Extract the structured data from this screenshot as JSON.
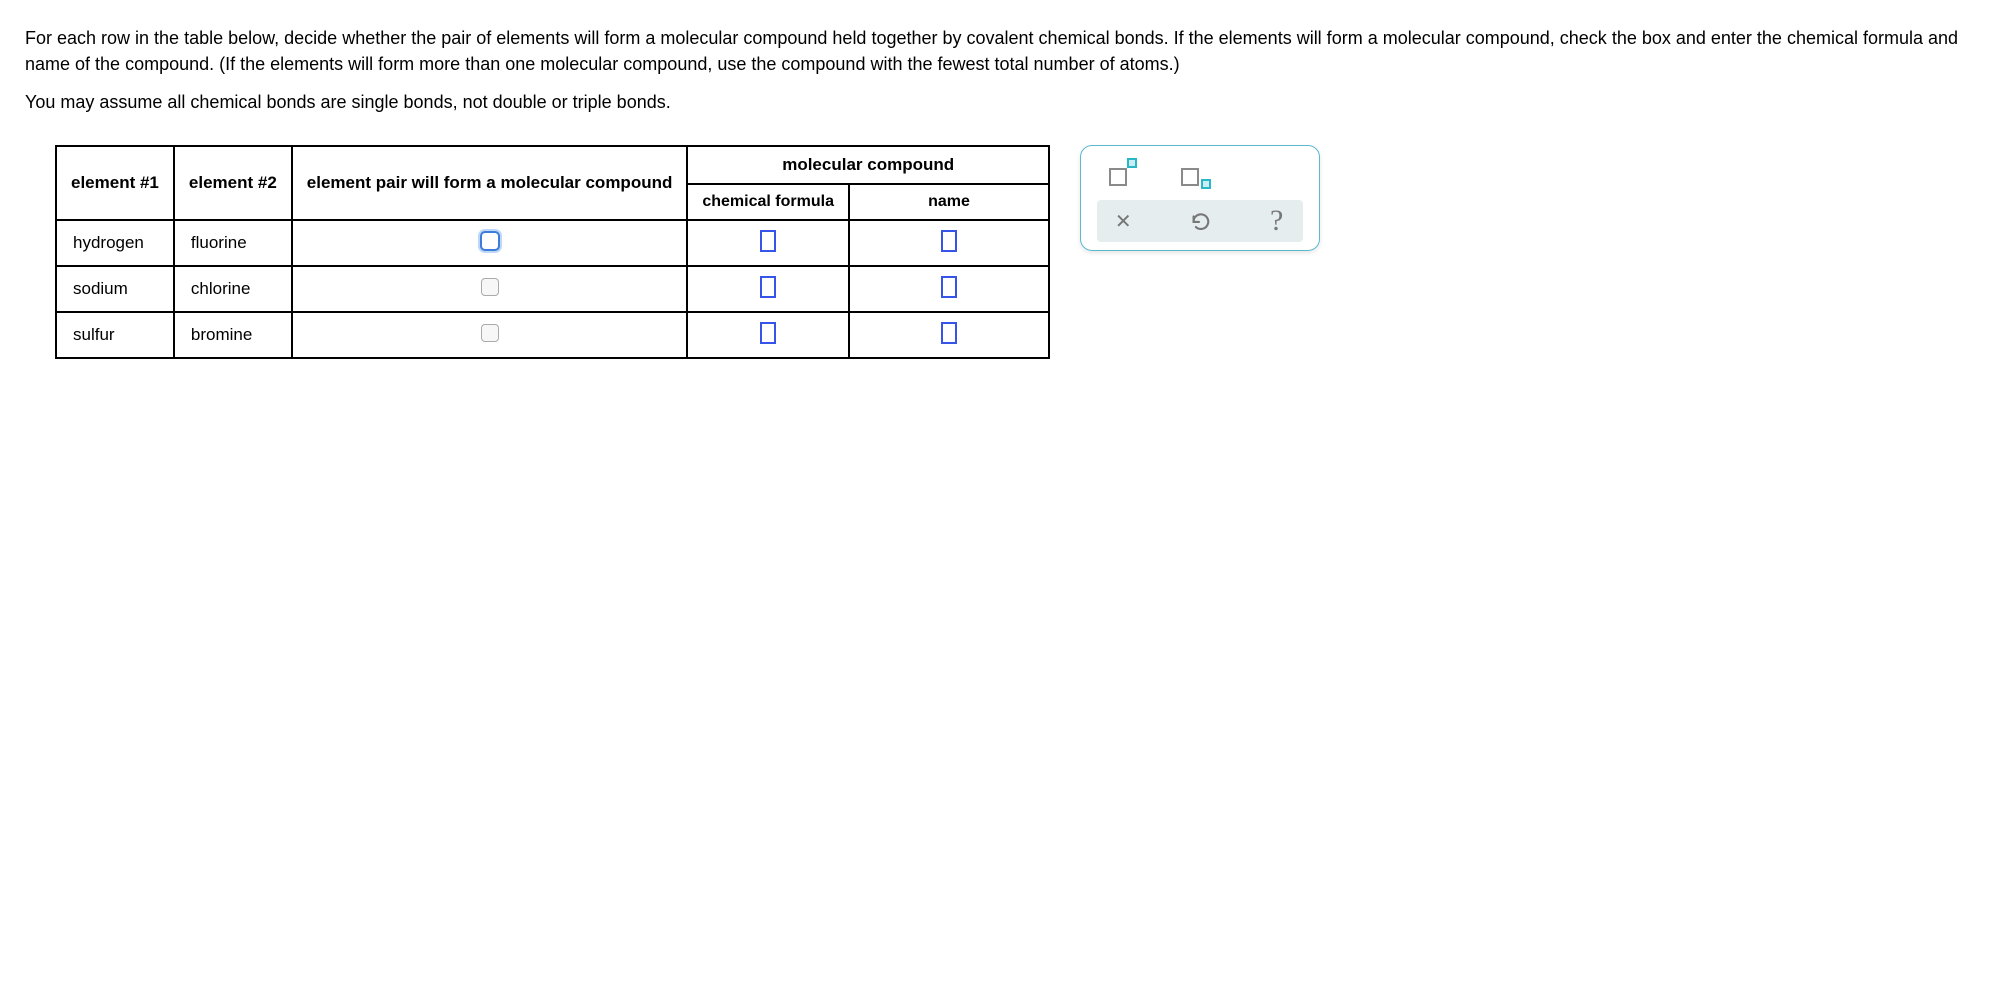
{
  "instructions": {
    "line1": "For each row in the table below, decide whether the pair of elements will form a molecular compound held together by covalent chemical bonds. If the elements will form a molecular compound, check the box and enter the chemical formula and name of the compound. (If the elements will form more than one molecular compound, use the compound with the fewest total number of atoms.)",
    "line2": "You may assume all chemical bonds are single bonds, not double or triple bonds."
  },
  "table": {
    "headers": {
      "element1": "element #1",
      "element2": "element #2",
      "will_form": "element pair will form a molecular compound",
      "mol_compound": "molecular compound",
      "formula": "chemical formula",
      "name": "name"
    },
    "rows": [
      {
        "elem1": "hydrogen",
        "elem2": "fluorine",
        "active": true
      },
      {
        "elem1": "sodium",
        "elem2": "chlorine",
        "active": false
      },
      {
        "elem1": "sulfur",
        "elem2": "bromine",
        "active": false
      }
    ]
  }
}
